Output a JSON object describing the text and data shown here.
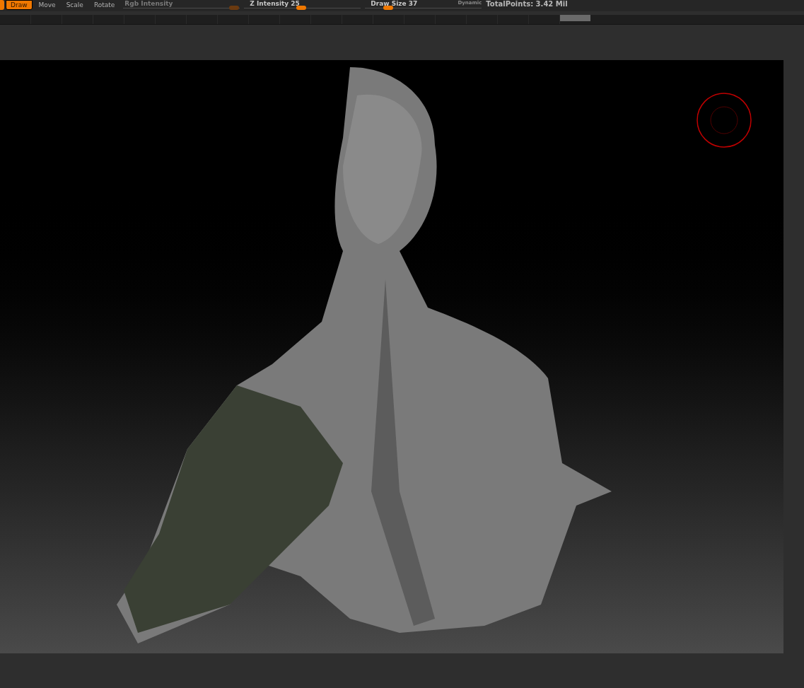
{
  "toolbar": {
    "buttons": [
      {
        "label": "Draw",
        "selected": true
      },
      {
        "label": "Move",
        "selected": false
      },
      {
        "label": "Scale",
        "selected": false
      },
      {
        "label": "Rotate",
        "selected": false
      }
    ],
    "sliders": [
      {
        "label": "Rgb Intensity",
        "disabled": true,
        "level": 0.95
      },
      {
        "label": "Z Intensity 25",
        "disabled": false,
        "level": 0.49
      },
      {
        "label": "Draw Size 37",
        "disabled": false,
        "level": 0.2,
        "note": "Dynamic"
      }
    ],
    "total_points": "TotalPoints: 3.42 Mil"
  }
}
